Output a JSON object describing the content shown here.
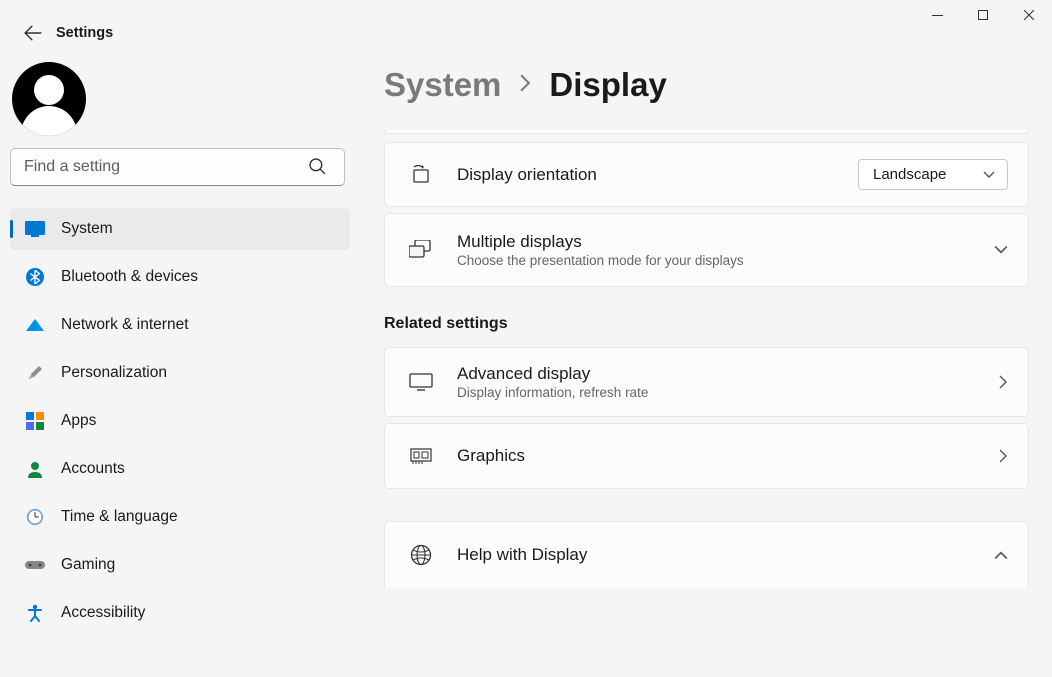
{
  "app_title": "Settings",
  "search": {
    "placeholder": "Find a setting"
  },
  "sidebar": {
    "items": [
      {
        "label": "System"
      },
      {
        "label": "Bluetooth & devices"
      },
      {
        "label": "Network & internet"
      },
      {
        "label": "Personalization"
      },
      {
        "label": "Apps"
      },
      {
        "label": "Accounts"
      },
      {
        "label": "Time & language"
      },
      {
        "label": "Gaming"
      },
      {
        "label": "Accessibility"
      }
    ]
  },
  "breadcrumb": {
    "parent": "System",
    "current": "Display"
  },
  "main": {
    "orientation": {
      "title": "Display orientation",
      "value": "Landscape"
    },
    "multiple": {
      "title": "Multiple displays",
      "subtitle": "Choose the presentation mode for your displays"
    },
    "section_related": "Related settings",
    "advanced": {
      "title": "Advanced display",
      "subtitle": "Display information, refresh rate"
    },
    "graphics": {
      "title": "Graphics"
    },
    "help": {
      "title": "Help with Display"
    }
  }
}
